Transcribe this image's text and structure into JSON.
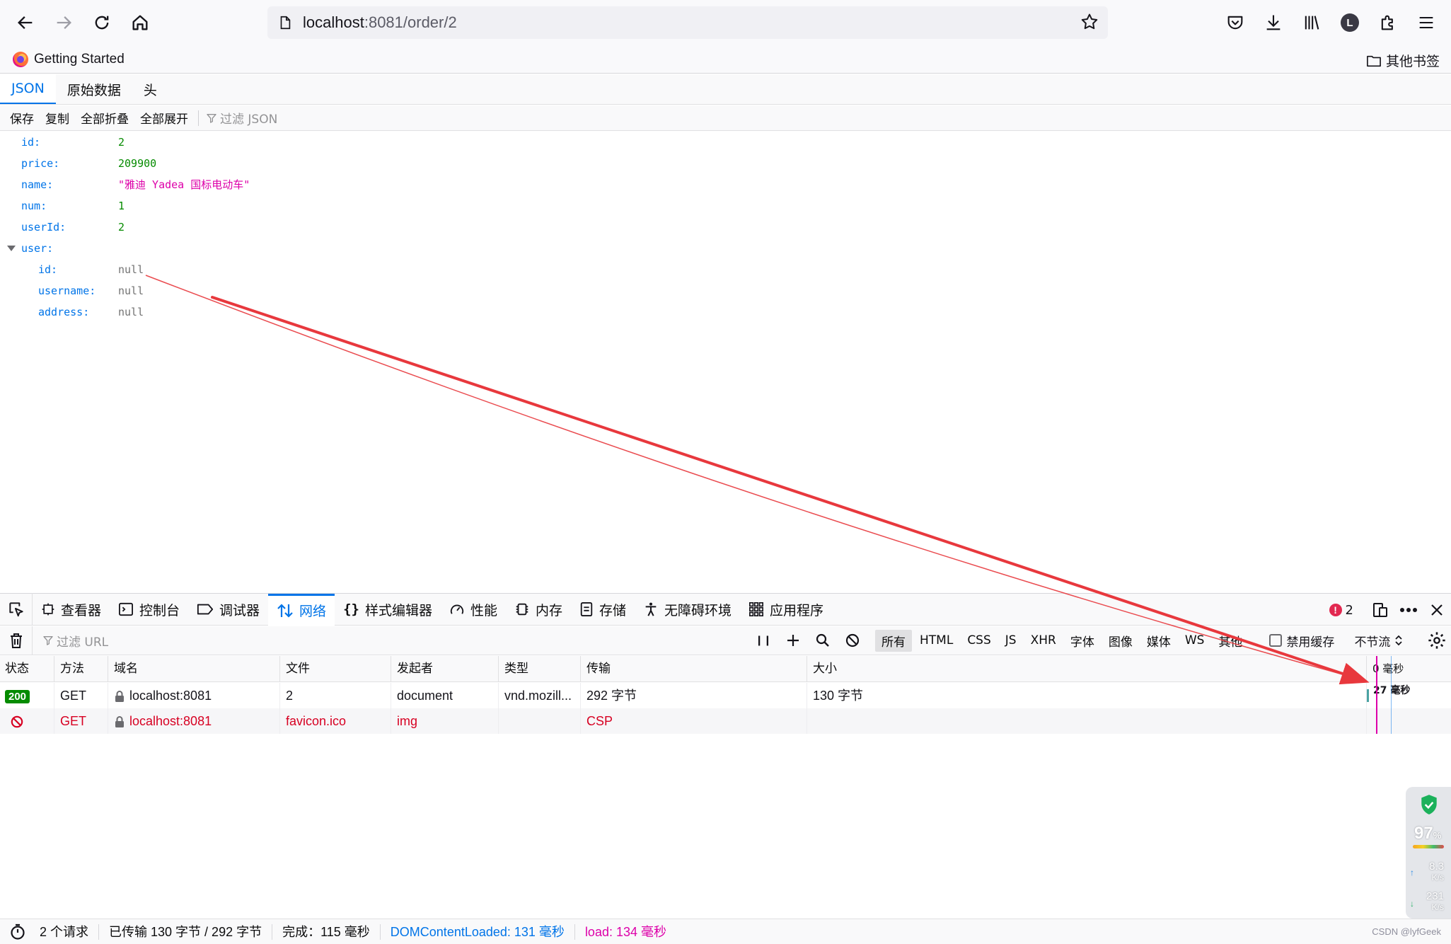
{
  "browser": {
    "url_host": "localhost",
    "url_rest": ":8081/order/2",
    "bookmark_getting_started": "Getting Started",
    "bookmark_other": "其他书签",
    "profile_initial": "L"
  },
  "json_viewer": {
    "tabs": [
      "JSON",
      "原始数据",
      "头"
    ],
    "toolbar": {
      "save": "保存",
      "copy": "复制",
      "collapse_all": "全部折叠",
      "expand_all": "全部展开",
      "filter_placeholder": "过滤 JSON"
    },
    "rows": [
      {
        "key": "id:",
        "value": "2",
        "type": "num"
      },
      {
        "key": "price:",
        "value": "209900",
        "type": "num"
      },
      {
        "key": "name:",
        "value": "\"雅迪 Yadea 国标电动车\"",
        "type": "str"
      },
      {
        "key": "num:",
        "value": "1",
        "type": "num"
      },
      {
        "key": "userId:",
        "value": "2",
        "type": "num"
      },
      {
        "key": "user:",
        "value": "",
        "type": "obj"
      },
      {
        "key": "id:",
        "value": "null",
        "type": "null"
      },
      {
        "key": "username:",
        "value": "null",
        "type": "null"
      },
      {
        "key": "address:",
        "value": "null",
        "type": "null"
      }
    ]
  },
  "devtools": {
    "tabs": [
      "查看器",
      "控制台",
      "调试器",
      "网络",
      "样式编辑器",
      "性能",
      "内存",
      "存储",
      "无障碍环境",
      "应用程序"
    ],
    "active_tab": "网络",
    "error_count": "2",
    "network": {
      "filter_placeholder": "过滤 URL",
      "pause_glyph": "❙❙",
      "types": [
        "所有",
        "HTML",
        "CSS",
        "JS",
        "XHR",
        "字体",
        "图像",
        "媒体",
        "WS",
        "其他"
      ],
      "disable_cache": "禁用缓存",
      "throttle": "不节流",
      "columns": [
        "状态",
        "方法",
        "域名",
        "文件",
        "发起者",
        "类型",
        "传输",
        "大小",
        "0 毫秒"
      ],
      "requests": [
        {
          "status": "200",
          "method": "GET",
          "domain": "localhost:8081",
          "file": "2",
          "initiator": "document",
          "type": "vnd.mozill...",
          "transferred": "292 字节",
          "size": "130 字节",
          "timing": "27 毫秒"
        },
        {
          "status": "blocked",
          "method": "GET",
          "domain": "localhost:8081",
          "file": "favicon.ico",
          "initiator": "img",
          "type": "",
          "transferred": "CSP",
          "size": "",
          "timing": ""
        }
      ]
    },
    "status_bar": {
      "requests": "2 个请求",
      "transferred": "已传输 130 字节 / 292 字节",
      "finish": "完成：115 毫秒",
      "dom_loaded": "DOMContentLoaded: 131 毫秒",
      "load": "load: 134 毫秒",
      "watermark": "CSDN @lyfGeek"
    }
  },
  "speed_widget": {
    "percent": "97",
    "percent_unit": "%",
    "upload": "8.3",
    "download": "231",
    "unit": "K/s"
  },
  "colors": {
    "accent": "#0074e8",
    "json_number": "#058b00",
    "json_string": "#dd00a9",
    "error": "#d70022",
    "annotation_arrow": "#e8383d"
  }
}
